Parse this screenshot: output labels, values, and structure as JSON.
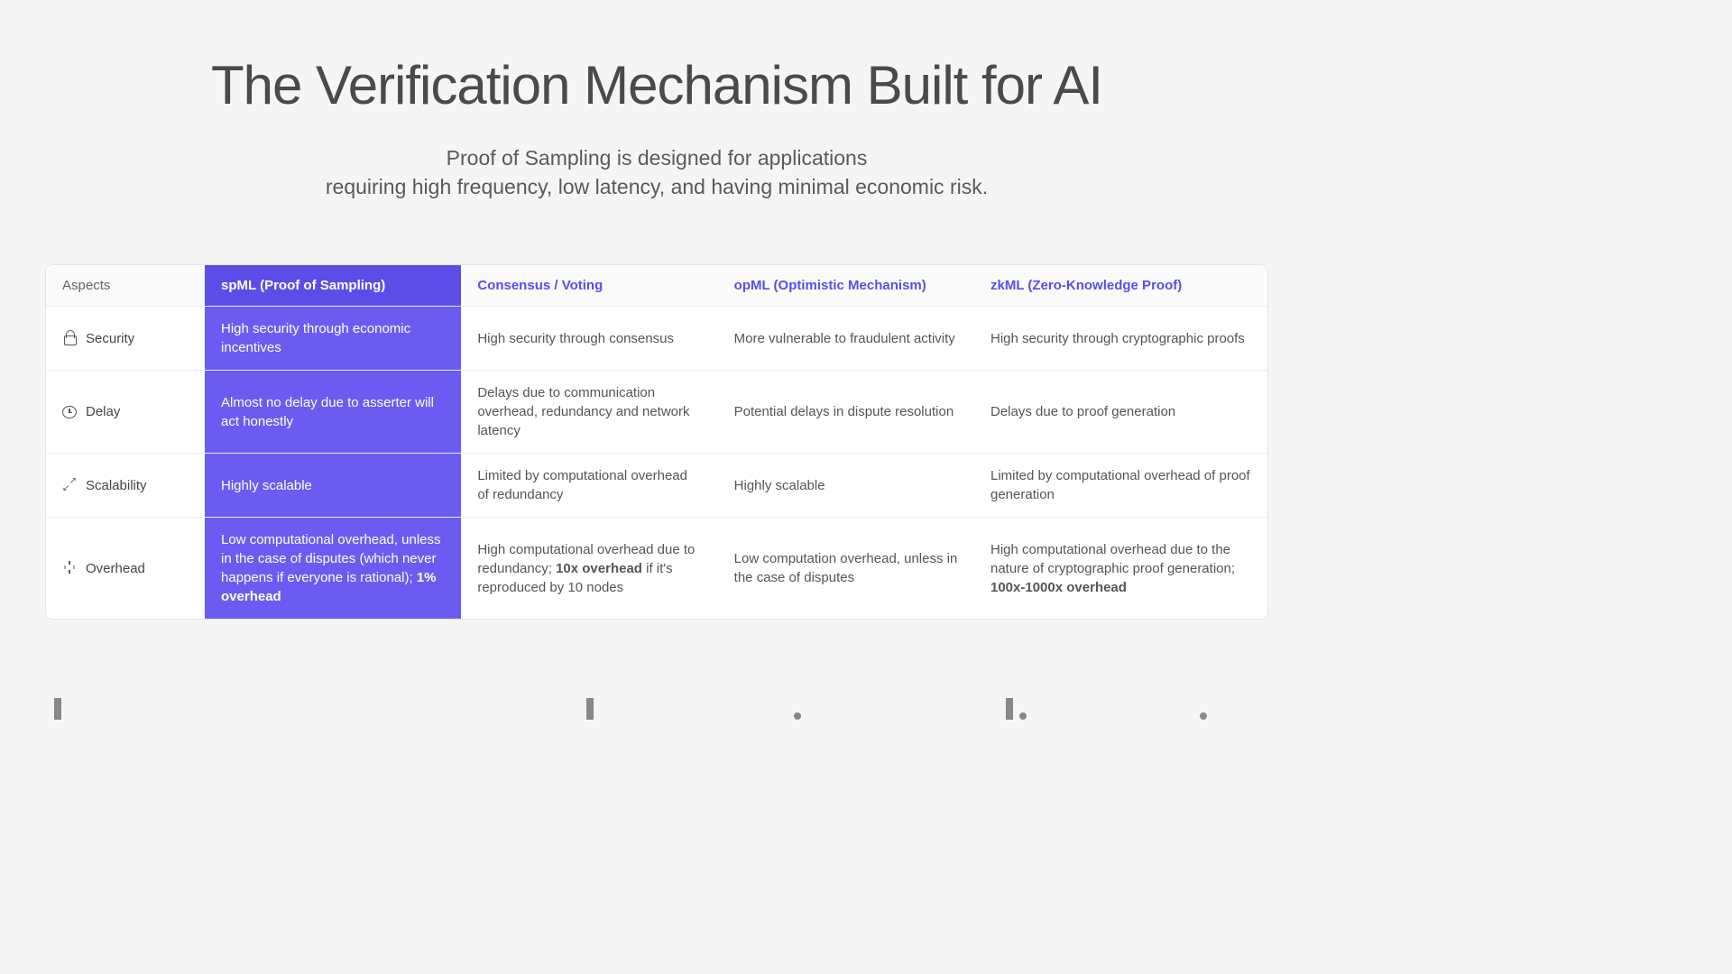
{
  "heading": {
    "title": "The Verification Mechanism Built for AI",
    "subtitle_l1": "Proof of Sampling is designed for applications",
    "subtitle_l2": "requiring high frequency, low latency, and having minimal economic risk."
  },
  "table": {
    "header": {
      "aspects": "Aspects",
      "spml": "spML (Proof of Sampling)",
      "consensus": "Consensus / Voting",
      "opml": "opML (Optimistic Mechanism)",
      "zkml": "zkML (Zero-Knowledge Proof)"
    },
    "rows": [
      {
        "aspect": "Security",
        "icon": "lock",
        "spml": "High security through economic incentives",
        "consensus": "High security through consensus",
        "opml": "More vulnerable to fraudulent activity",
        "zkml": "High security through cryptographic proofs"
      },
      {
        "aspect": "Delay",
        "icon": "clock",
        "spml": "Almost no delay due to asserter will act honestly",
        "consensus": "Delays due to communication overhead, redundancy and network latency",
        "opml": "Potential delays in dispute resolution",
        "zkml": "Delays due to proof generation"
      },
      {
        "aspect": "Scalability",
        "icon": "expand",
        "spml": "Highly scalable",
        "consensus": "Limited by computational overhead of redundancy",
        "opml": "Highly scalable",
        "zkml": "Limited by computational overhead of proof generation"
      },
      {
        "aspect": "Overhead",
        "icon": "spinner",
        "spml_pre": "Low computational overhead, unless in the case of disputes (which never happens if everyone is rational); ",
        "spml_bold": "1% overhead",
        "consensus_pre": "High computational overhead due to redundancy; ",
        "consensus_bold": "10x overhead",
        "consensus_post": " if it's reproduced by 10 nodes",
        "opml": "Low computation overhead, unless in the case of disputes",
        "zkml_pre": "High computational overhead due to the nature of cryptographic proof generation; ",
        "zkml_bold": "100x-1000x overhead"
      }
    ]
  }
}
